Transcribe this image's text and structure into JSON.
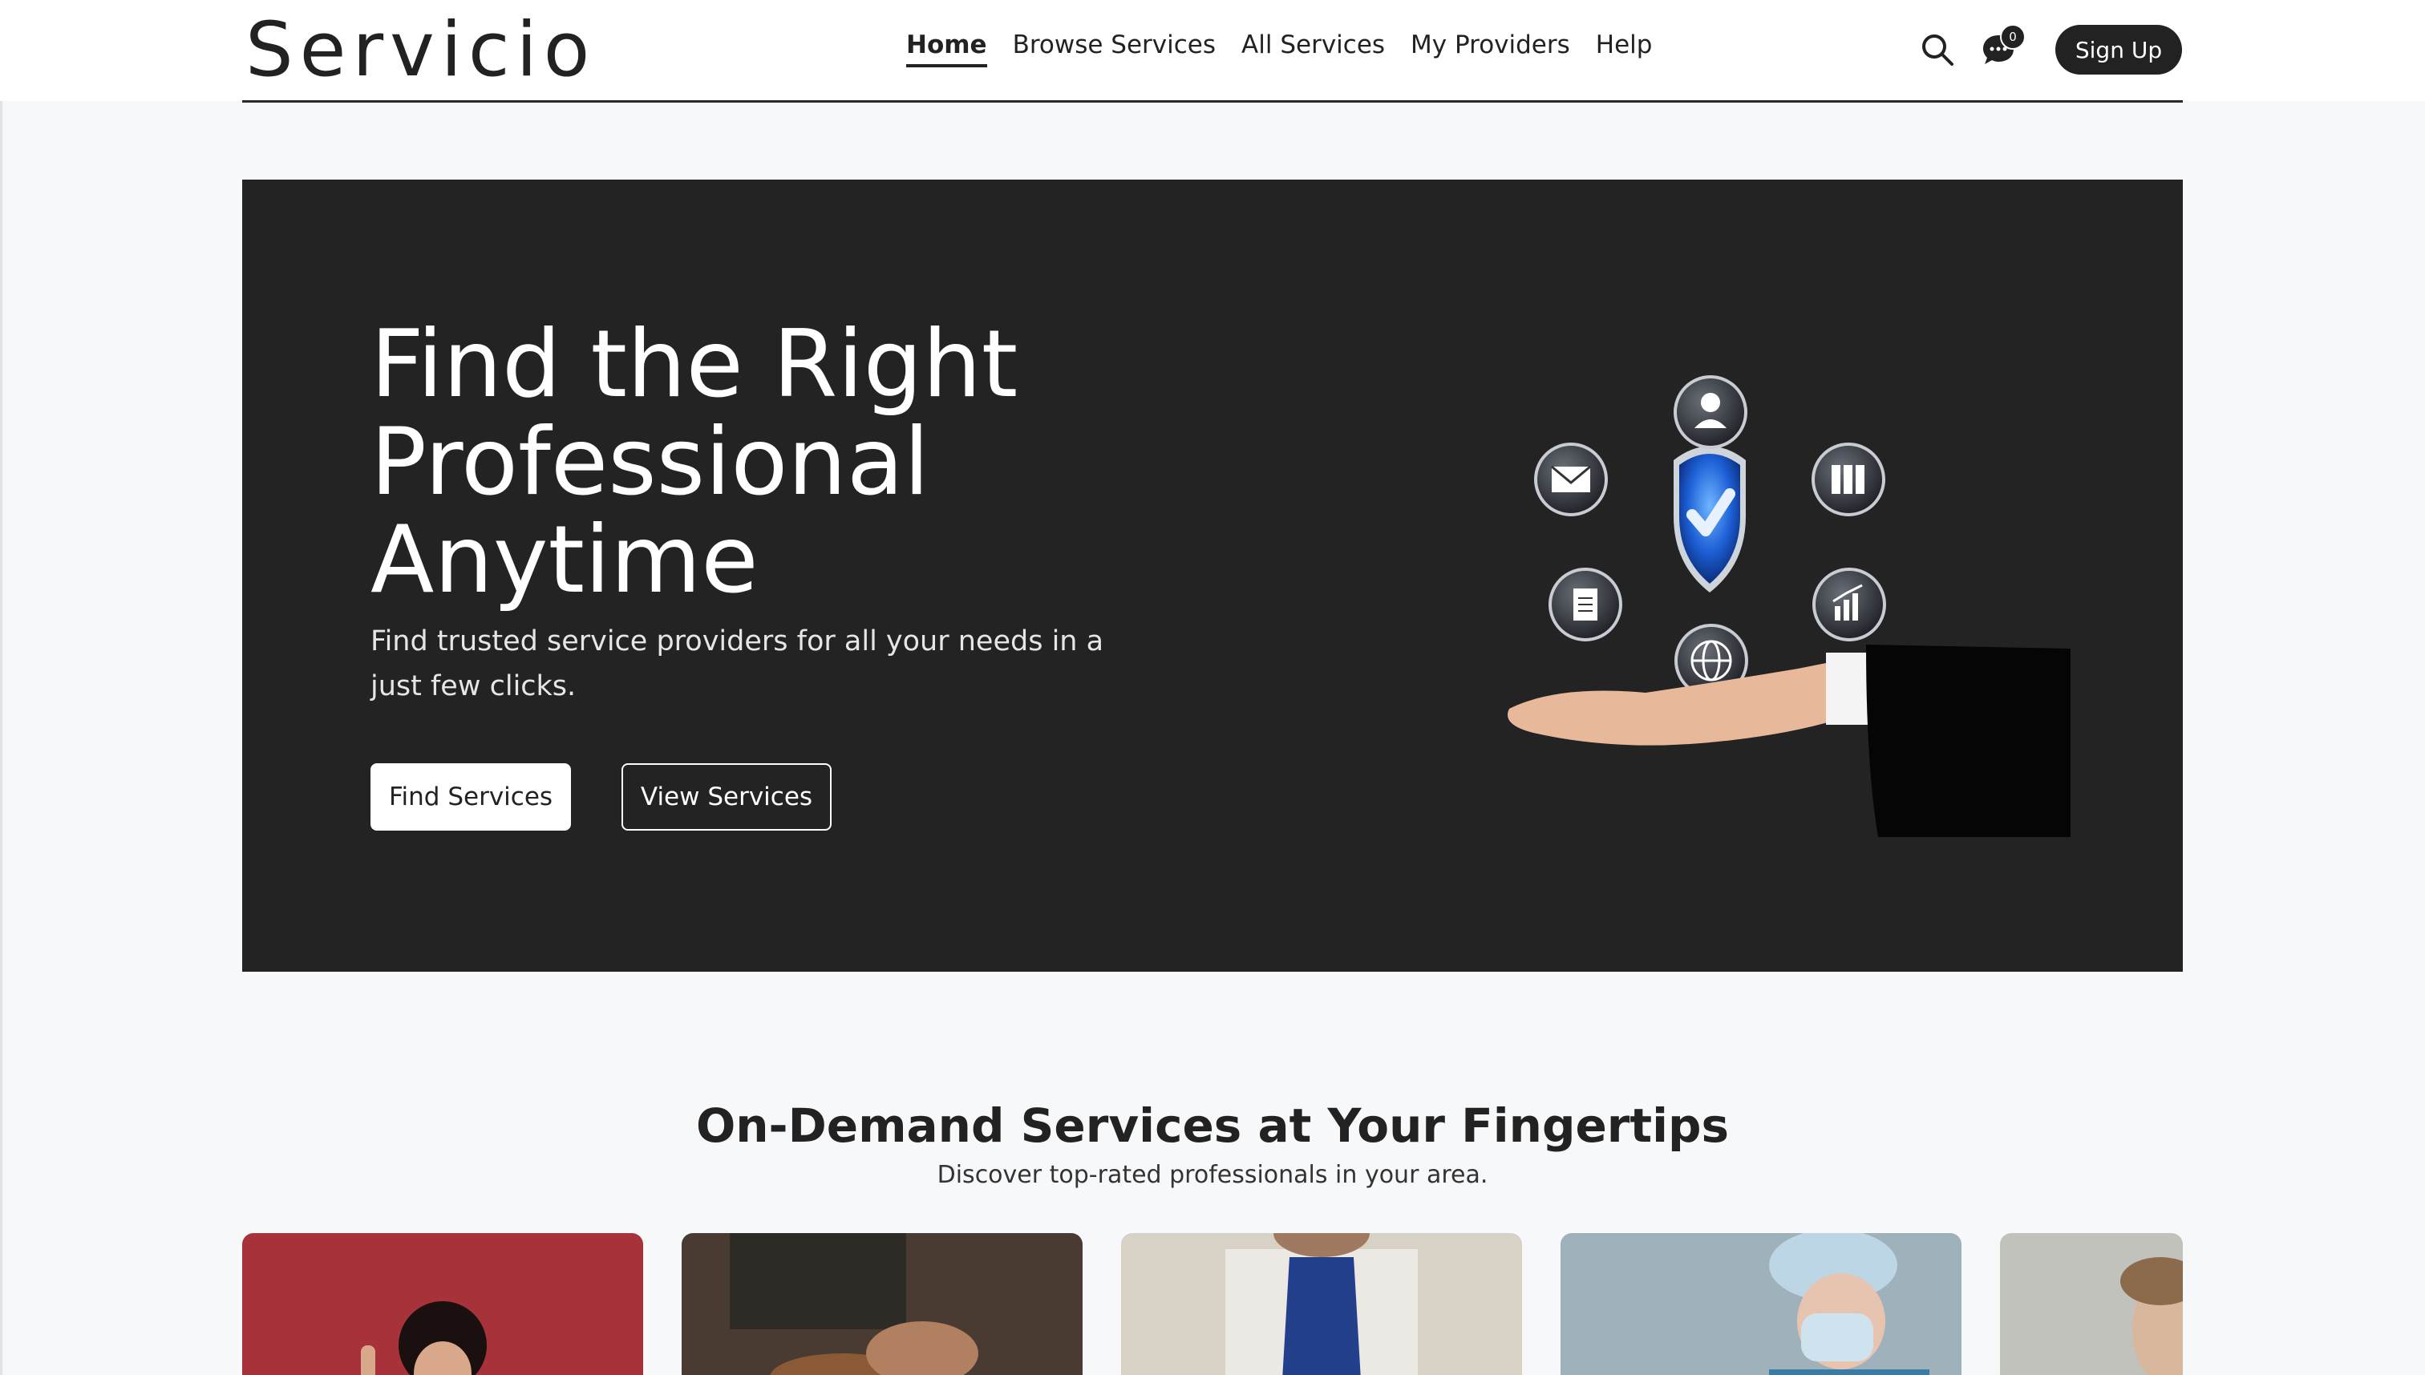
{
  "brand": {
    "logo_text": "Servicio",
    "accent_dark": "#232323",
    "page_bg": "#f7f8fa"
  },
  "nav": {
    "items": [
      {
        "label": "Home",
        "active": true
      },
      {
        "label": "Browse Services",
        "active": false
      },
      {
        "label": "All Services",
        "active": false
      },
      {
        "label": "My Providers",
        "active": false
      },
      {
        "label": "Help",
        "active": false
      }
    ]
  },
  "header_actions": {
    "search_icon": "search-icon",
    "chat_icon": "chat-bubble-icon",
    "chat_badge_count": "0",
    "signup_label": "Sign Up"
  },
  "hero": {
    "title_line1": "Find the Right",
    "title_line2": "Professional",
    "title_line3": "Anytime",
    "subtitle": "Find trusted service providers for all your needs in a just few clicks.",
    "primary_cta": "Find Services",
    "secondary_cta": "View Services",
    "illustration_icons": [
      "shield-check-icon",
      "person-icon",
      "envelope-icon",
      "folders-icon",
      "clipboard-icon",
      "bar-chart-icon",
      "globe-icon",
      "open-hand-icon"
    ]
  },
  "section": {
    "title": "On-Demand Services at Your Fingertips",
    "subtitle": "Discover top-rated professionals in your area."
  },
  "service_cards": [
    {
      "image": "person-thumbs-up-photo",
      "bg": "#a8323a"
    },
    {
      "image": "woodworking-photo",
      "bg": "#4a3b32"
    },
    {
      "image": "apron-chef-photo",
      "bg": "#c9c2b8"
    },
    {
      "image": "surgeon-photo",
      "bg": "#8fa3ad"
    },
    {
      "image": "doctor-photo",
      "bg": "#b8b8b4"
    }
  ]
}
